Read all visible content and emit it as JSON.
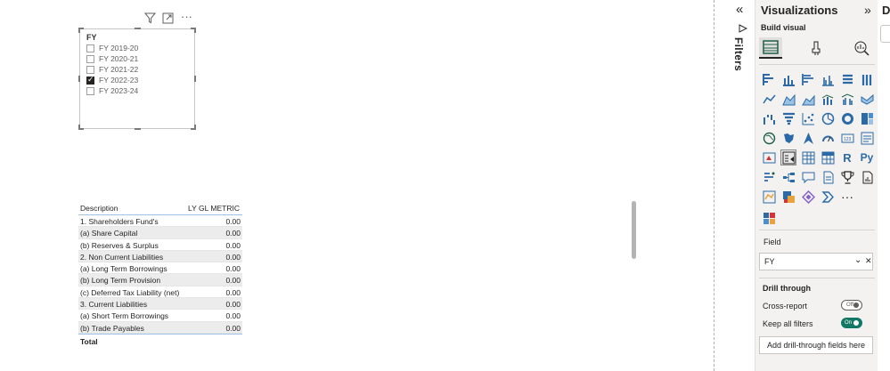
{
  "slicer": {
    "header_icons": [
      "filter-icon",
      "focus-mode-icon",
      "more-options-icon"
    ],
    "title": "FY",
    "items": [
      {
        "label": "FY 2019-20",
        "checked": false
      },
      {
        "label": "FY 2020-21",
        "checked": false
      },
      {
        "label": "FY 2021-22",
        "checked": false
      },
      {
        "label": "FY 2022-23",
        "checked": true
      },
      {
        "label": "FY 2023-24",
        "checked": false
      }
    ]
  },
  "table": {
    "columns": [
      "Description",
      "LY GL METRIC"
    ],
    "rows": [
      [
        "1. Shareholders Fund's",
        "0.00"
      ],
      [
        "(a) Share Capital",
        "0.00"
      ],
      [
        "(b) Reserves & Surplus",
        "0.00"
      ],
      [
        "2. Non Current Liabilities",
        "0.00"
      ],
      [
        "(a) Long Term Borrowings",
        "0.00"
      ],
      [
        "(b) Long Term Provision",
        "0.00"
      ],
      [
        "(c) Deferred Tax Liability (net)",
        "0.00"
      ],
      [
        "3. Current Liabilities",
        "0.00"
      ],
      [
        "(a) Short Term Borrowings",
        "0.00"
      ],
      [
        "(b) Trade Payables",
        "0.00"
      ]
    ],
    "total_label": "Total"
  },
  "filters_pane": {
    "collapse_glyph": "«",
    "label": "Filters"
  },
  "visualizations": {
    "title": "Visualizations",
    "expand_glyph": "»",
    "build_visual": "Build visual",
    "field_label": "Field",
    "field_value": "FY",
    "drill_through": "Drill through",
    "cross_report": "Cross-report",
    "cross_report_state": "Off",
    "keep_all_filters": "Keep all filters",
    "keep_all_filters_state": "On",
    "add_drill_through": "Add drill-through fields here",
    "more_visuals": "···",
    "r_visual": "R",
    "py_visual": "Py"
  },
  "right_pane": {
    "title_initial": "D"
  },
  "colors": {
    "accent_blue": "#2b6aa6",
    "toggle_on": "#117865",
    "table_header_rule": "#9ec3e6"
  }
}
